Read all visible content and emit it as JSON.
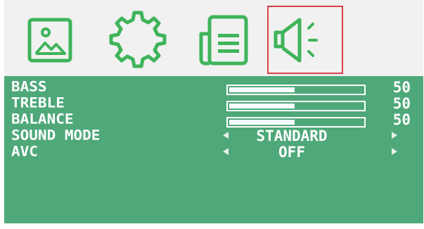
{
  "menu": {
    "tabs": [
      {
        "name": "picture",
        "icon": "picture-icon"
      },
      {
        "name": "setup",
        "icon": "gear-icon"
      },
      {
        "name": "menu",
        "icon": "document-list-icon"
      },
      {
        "name": "sound",
        "icon": "speaker-icon",
        "selected": true
      }
    ],
    "accent_color": "#3fb45a",
    "selection_color": "#d9414b",
    "panel_color": "#4fa879"
  },
  "sound": {
    "bass": {
      "label": "BASS",
      "value": "50",
      "level": 0.5
    },
    "treble": {
      "label": "TREBLE",
      "value": "50",
      "level": 0.5
    },
    "balance": {
      "label": "BALANCE",
      "value": "50",
      "level": 0.5
    },
    "sound_mode": {
      "label": "SOUND MODE",
      "value": "STANDARD"
    },
    "avc": {
      "label": "AVC",
      "value": "OFF"
    }
  }
}
